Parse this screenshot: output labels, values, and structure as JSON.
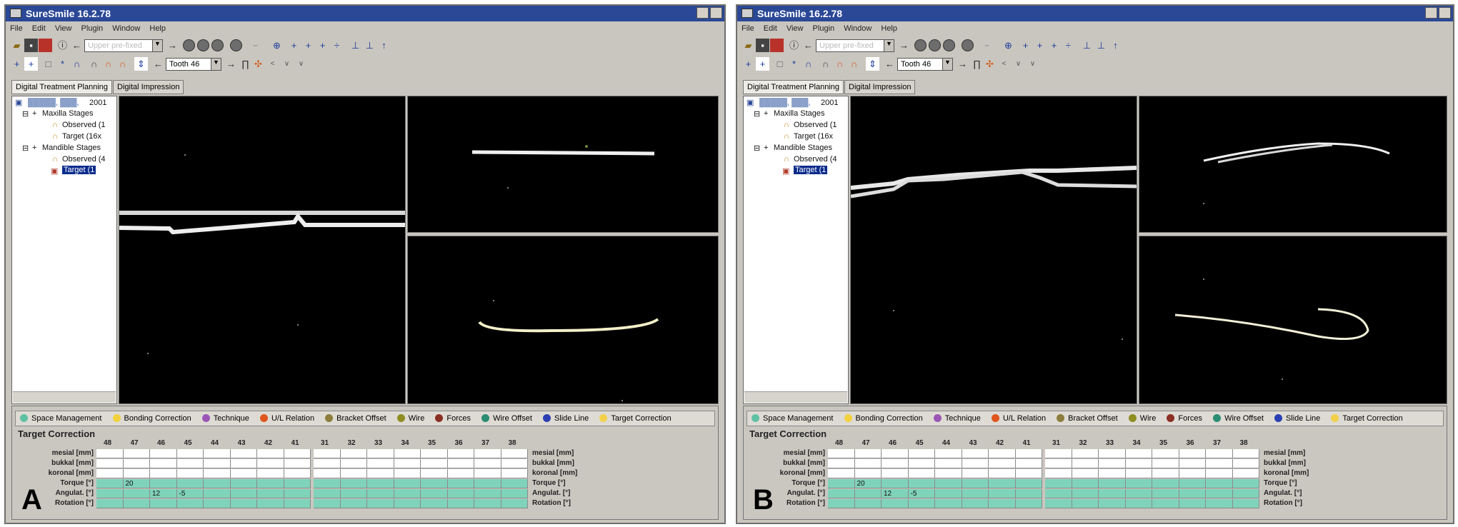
{
  "app": {
    "title": "SureSmile 16.2.78",
    "menu": [
      "File",
      "Edit",
      "View",
      "Plugin",
      "Window",
      "Help"
    ],
    "toolbar": {
      "stage_combo_value": "Upper pre-fixed",
      "tooth_combo_value": "Tooth 46"
    },
    "tabs": [
      "Digital Treatment Planning",
      "Digital Impression"
    ],
    "bottom_tabs": [
      {
        "label": "Space Management",
        "color": "#5fc1a4"
      },
      {
        "label": "Bonding Correction",
        "color": "#f2d13c"
      },
      {
        "label": "Technique",
        "color": "#9a57b6"
      },
      {
        "label": "U/L Relation",
        "color": "#e0561e"
      },
      {
        "label": "Bracket Offset",
        "color": "#8c7d3c"
      },
      {
        "label": "Wire",
        "color": "#8e8e22"
      },
      {
        "label": "Forces",
        "color": "#8b2f24"
      },
      {
        "label": "Wire Offset",
        "color": "#2b8d73"
      },
      {
        "label": "Slide Line",
        "color": "#2b3fb3"
      },
      {
        "label": "Target Correction",
        "color": "#f3d04a"
      }
    ],
    "section_title": "Target Correction",
    "teeth": [
      "48",
      "47",
      "46",
      "45",
      "44",
      "43",
      "42",
      "41",
      "31",
      "32",
      "33",
      "34",
      "35",
      "36",
      "37",
      "38"
    ],
    "row_labels": [
      "mesial [mm]",
      "bukkal [mm]",
      "koronal [mm]",
      "Torque [°]",
      "Angulat. [°]",
      "Rotation [°]"
    ],
    "values": {
      "torque_47": "20",
      "angulat_46": "12",
      "angulat_45": "-5"
    },
    "colors": {
      "titlebar": "#2b4896",
      "green_row": "#7fd3ba",
      "viewport": "#000000"
    }
  },
  "panels": [
    {
      "letter": "A",
      "tree": {
        "root_label": "2001",
        "maxilla_stages": "Maxilla Stages",
        "maxilla_observed": "Observed (1",
        "maxilla_target": "Target (16x",
        "mandible_stages": "Mandible Stages",
        "mandible_observed": "Observed (4",
        "mandible_target": "Target (1"
      }
    },
    {
      "letter": "B",
      "tree": {
        "root_label": "2001",
        "maxilla_stages": "Maxilla Stages",
        "maxilla_observed": "Observed (1",
        "maxilla_target": "Target (16x",
        "mandible_stages": "Mandible Stages",
        "mandible_observed": "Observed (4",
        "mandible_target": "Target (1"
      }
    }
  ]
}
